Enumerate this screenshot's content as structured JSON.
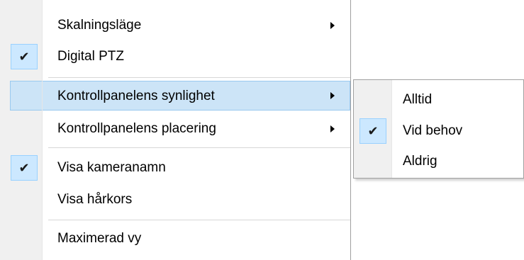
{
  "main_menu": {
    "items": [
      {
        "label": "Skalningsläge",
        "checked": false,
        "has_submenu": true,
        "highlighted": false
      },
      {
        "label": "Digital PTZ",
        "checked": true,
        "has_submenu": false,
        "highlighted": false
      },
      {
        "label": "Kontrollpanelens synlighet",
        "checked": false,
        "has_submenu": true,
        "highlighted": true
      },
      {
        "label": "Kontrollpanelens placering",
        "checked": false,
        "has_submenu": true,
        "highlighted": false
      },
      {
        "label": "Visa kameranamn",
        "checked": true,
        "has_submenu": false,
        "highlighted": false
      },
      {
        "label": "Visa hårkors",
        "checked": false,
        "has_submenu": false,
        "highlighted": false
      },
      {
        "label": "Maximerad vy",
        "checked": false,
        "has_submenu": false,
        "highlighted": false
      }
    ],
    "check_glyph": "✔",
    "highlight_color": "#cce4f7"
  },
  "submenu": {
    "items": [
      {
        "label": "Alltid",
        "checked": false
      },
      {
        "label": "Vid behov",
        "checked": true
      },
      {
        "label": "Aldrig",
        "checked": false
      }
    ]
  }
}
